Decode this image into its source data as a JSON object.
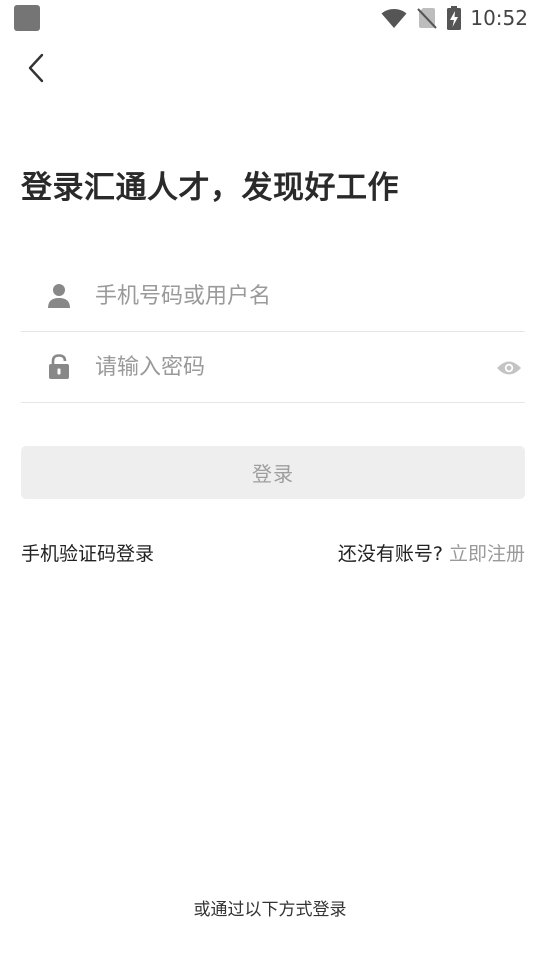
{
  "status_bar": {
    "time": "10:52",
    "icons": [
      "app-icon",
      "wifi-icon",
      "no-sim-icon",
      "battery-charging-icon"
    ]
  },
  "header": {
    "back_icon": "chevron-left-icon"
  },
  "login_page": {
    "title": "登录汇通人才，发现好工作",
    "username_field": {
      "icon": "user-icon",
      "placeholder": "手机号码或用户名",
      "value": ""
    },
    "password_field": {
      "icon": "lock-icon",
      "placeholder": "请输入密码",
      "value": "",
      "visibility_icon": "eye-icon"
    },
    "login_button_label": "登录",
    "sms_login_label": "手机验证码登录",
    "register_question": "还没有账号?",
    "register_link_label": "立即注册",
    "other_login_title": "或通过以下方式登录"
  },
  "colors": {
    "primary_text": "#222222",
    "placeholder": "#9a9a9a",
    "icon_gray": "#888888",
    "button_bg": "#eeeeee",
    "button_text": "#9e9e9e",
    "divider": "#e6e6e6"
  }
}
